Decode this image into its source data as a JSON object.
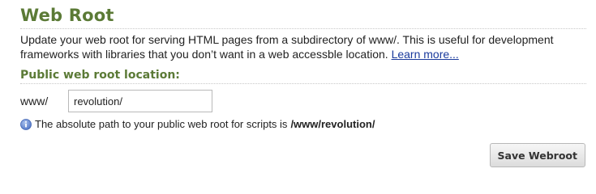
{
  "header": {
    "title": "Web Root"
  },
  "description": {
    "text": "Update your web root for serving HTML pages from a subdirectory of www/. This is useful for development frameworks with libraries that you don’t want in a web accessble location. ",
    "link_text": "Learn more..."
  },
  "section": {
    "title": "Public web root location:"
  },
  "field": {
    "prefix": "www/",
    "value": "revolution/"
  },
  "info": {
    "icon": "info-icon",
    "text": "The absolute path to your public web root for scripts is",
    "path": "/www/revolution/"
  },
  "actions": {
    "save_label": "Save Webroot"
  },
  "colors": {
    "heading": "#5b7a36",
    "link": "#1a3a9c",
    "info_icon": "#6f8fd0"
  }
}
